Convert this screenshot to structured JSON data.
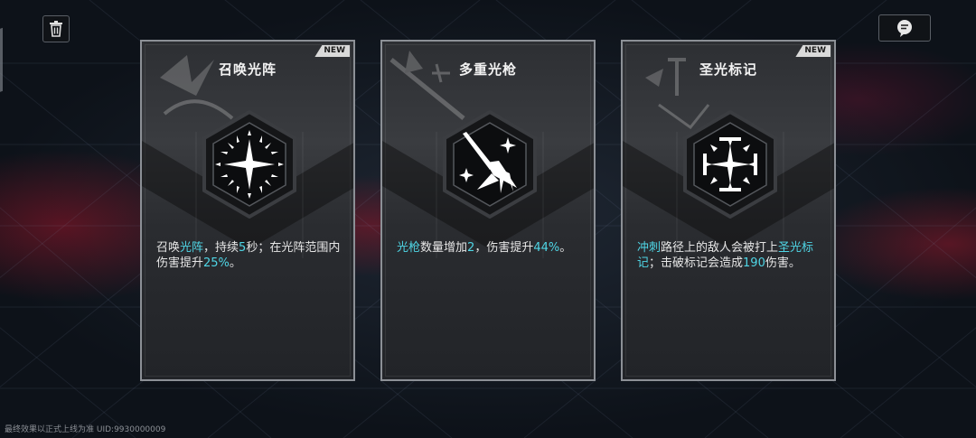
{
  "footer": {
    "note": "最终效果以正式上线为准 UID:9930000009"
  },
  "cards": [
    {
      "title": "召唤光阵",
      "badge": "NEW",
      "icon": "summon-light-array-icon",
      "desc": [
        {
          "t": "召唤"
        },
        {
          "t": "光阵",
          "hl": true
        },
        {
          "t": "，持续"
        },
        {
          "t": "5",
          "hl": true
        },
        {
          "t": "秒；在光阵范围内伤害提升"
        },
        {
          "t": "25%",
          "hl": true
        },
        {
          "t": "。"
        }
      ]
    },
    {
      "title": "多重光枪",
      "badge": "",
      "icon": "multi-light-spear-icon",
      "desc": [
        {
          "t": "光枪",
          "hl": true
        },
        {
          "t": "数量增加"
        },
        {
          "t": "2",
          "hl": true
        },
        {
          "t": "，伤害提升"
        },
        {
          "t": "44%",
          "hl": true
        },
        {
          "t": "。"
        }
      ]
    },
    {
      "title": "圣光标记",
      "badge": "NEW",
      "icon": "holy-light-mark-icon",
      "desc": [
        {
          "t": "冲刺",
          "hl": true
        },
        {
          "t": "路径上的敌人会被打上"
        },
        {
          "t": "圣光标记",
          "hl": true
        },
        {
          "t": "；击破标记会造成"
        },
        {
          "t": "190",
          "hl": true
        },
        {
          "t": "伤害。"
        }
      ]
    }
  ],
  "colors": {
    "highlight": "#4fd6e6",
    "card_border": "#8c9096"
  }
}
